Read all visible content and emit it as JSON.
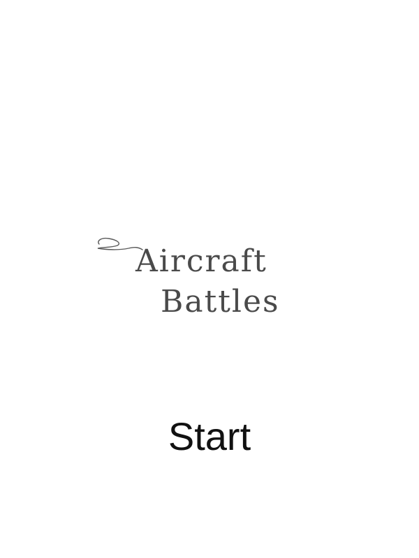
{
  "logo": {
    "line1": "Aircraft",
    "line2": "Battles",
    "ink_color": "#4a4a4a",
    "icon": "flourish-swirl-icon"
  },
  "menu": {
    "start_label": "Start",
    "text_color": "#111111"
  },
  "background_color": "#ffffff"
}
